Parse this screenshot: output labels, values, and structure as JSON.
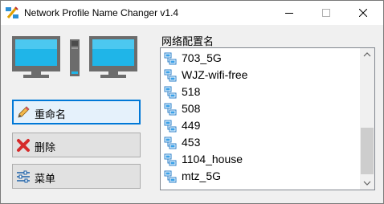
{
  "window": {
    "title": "Network Profile Name Changer v1.4"
  },
  "hero": {
    "illustration": "two-computers-network-icon"
  },
  "actions": {
    "rename_label": "重命名",
    "delete_label": "删除",
    "menu_label": "菜单"
  },
  "profiles": {
    "label": "网络配置名",
    "items": [
      "703_5G",
      "WJZ-wifi-free",
      "518",
      "508",
      "449",
      "453",
      "1104_house",
      "mtz_5G"
    ]
  },
  "colors": {
    "accent": "#0078d7",
    "monitor_screen": "#1fb5e8",
    "delete_red": "#d62b2b"
  },
  "icons": {
    "minimize": "minimize-icon",
    "maximize": "maximize-icon",
    "close": "close-icon",
    "rename": "pencil-icon",
    "delete": "red-x-icon",
    "menu": "sliders-icon",
    "profile": "network-icon"
  }
}
